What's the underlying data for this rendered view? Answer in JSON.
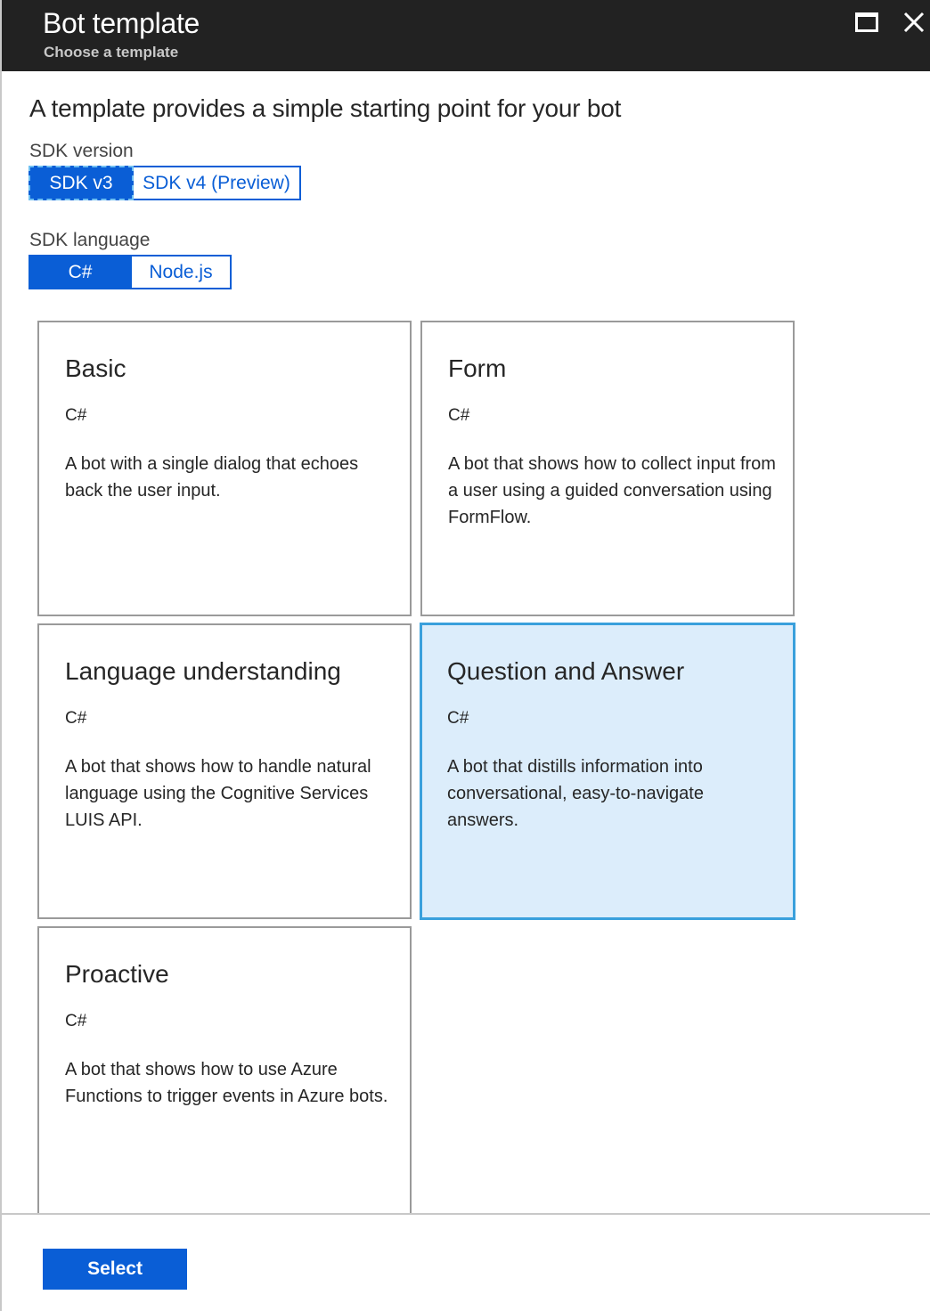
{
  "header": {
    "title": "Bot template",
    "subtitle": "Choose a template"
  },
  "lead": "A template provides a simple starting point for your bot",
  "sdk_version": {
    "label": "SDK version",
    "options": [
      "SDK v3",
      "SDK v4 (Preview)"
    ],
    "selected": "SDK v3"
  },
  "sdk_language": {
    "label": "SDK language",
    "options": [
      "C#",
      "Node.js"
    ],
    "selected": "C#"
  },
  "templates": [
    {
      "name": "Basic",
      "lang": "C#",
      "desc": "A bot with a single dialog that echoes back the user input."
    },
    {
      "name": "Form",
      "lang": "C#",
      "desc": "A bot that shows how to collect input from a user using a guided conversation using FormFlow."
    },
    {
      "name": "Language understanding",
      "lang": "C#",
      "desc": "A bot that shows how to handle natural language using the Cognitive Services LUIS API."
    },
    {
      "name": "Question and Answer",
      "lang": "C#",
      "desc": "A bot that distills information into conversational, easy-to-navigate answers."
    },
    {
      "name": "Proactive",
      "lang": "C#",
      "desc": "A bot that shows how to use Azure Functions to trigger events in Azure bots."
    }
  ],
  "selected_template": "Question and Answer",
  "footer": {
    "select_label": "Select"
  },
  "colors": {
    "accent": "#0a5ed6",
    "header_bg": "#222222",
    "selected_card_bg": "#dcedfb",
    "selected_card_border": "#3aa0dc"
  },
  "icons": {
    "maximize": "maximize-icon",
    "close": "close-icon"
  }
}
